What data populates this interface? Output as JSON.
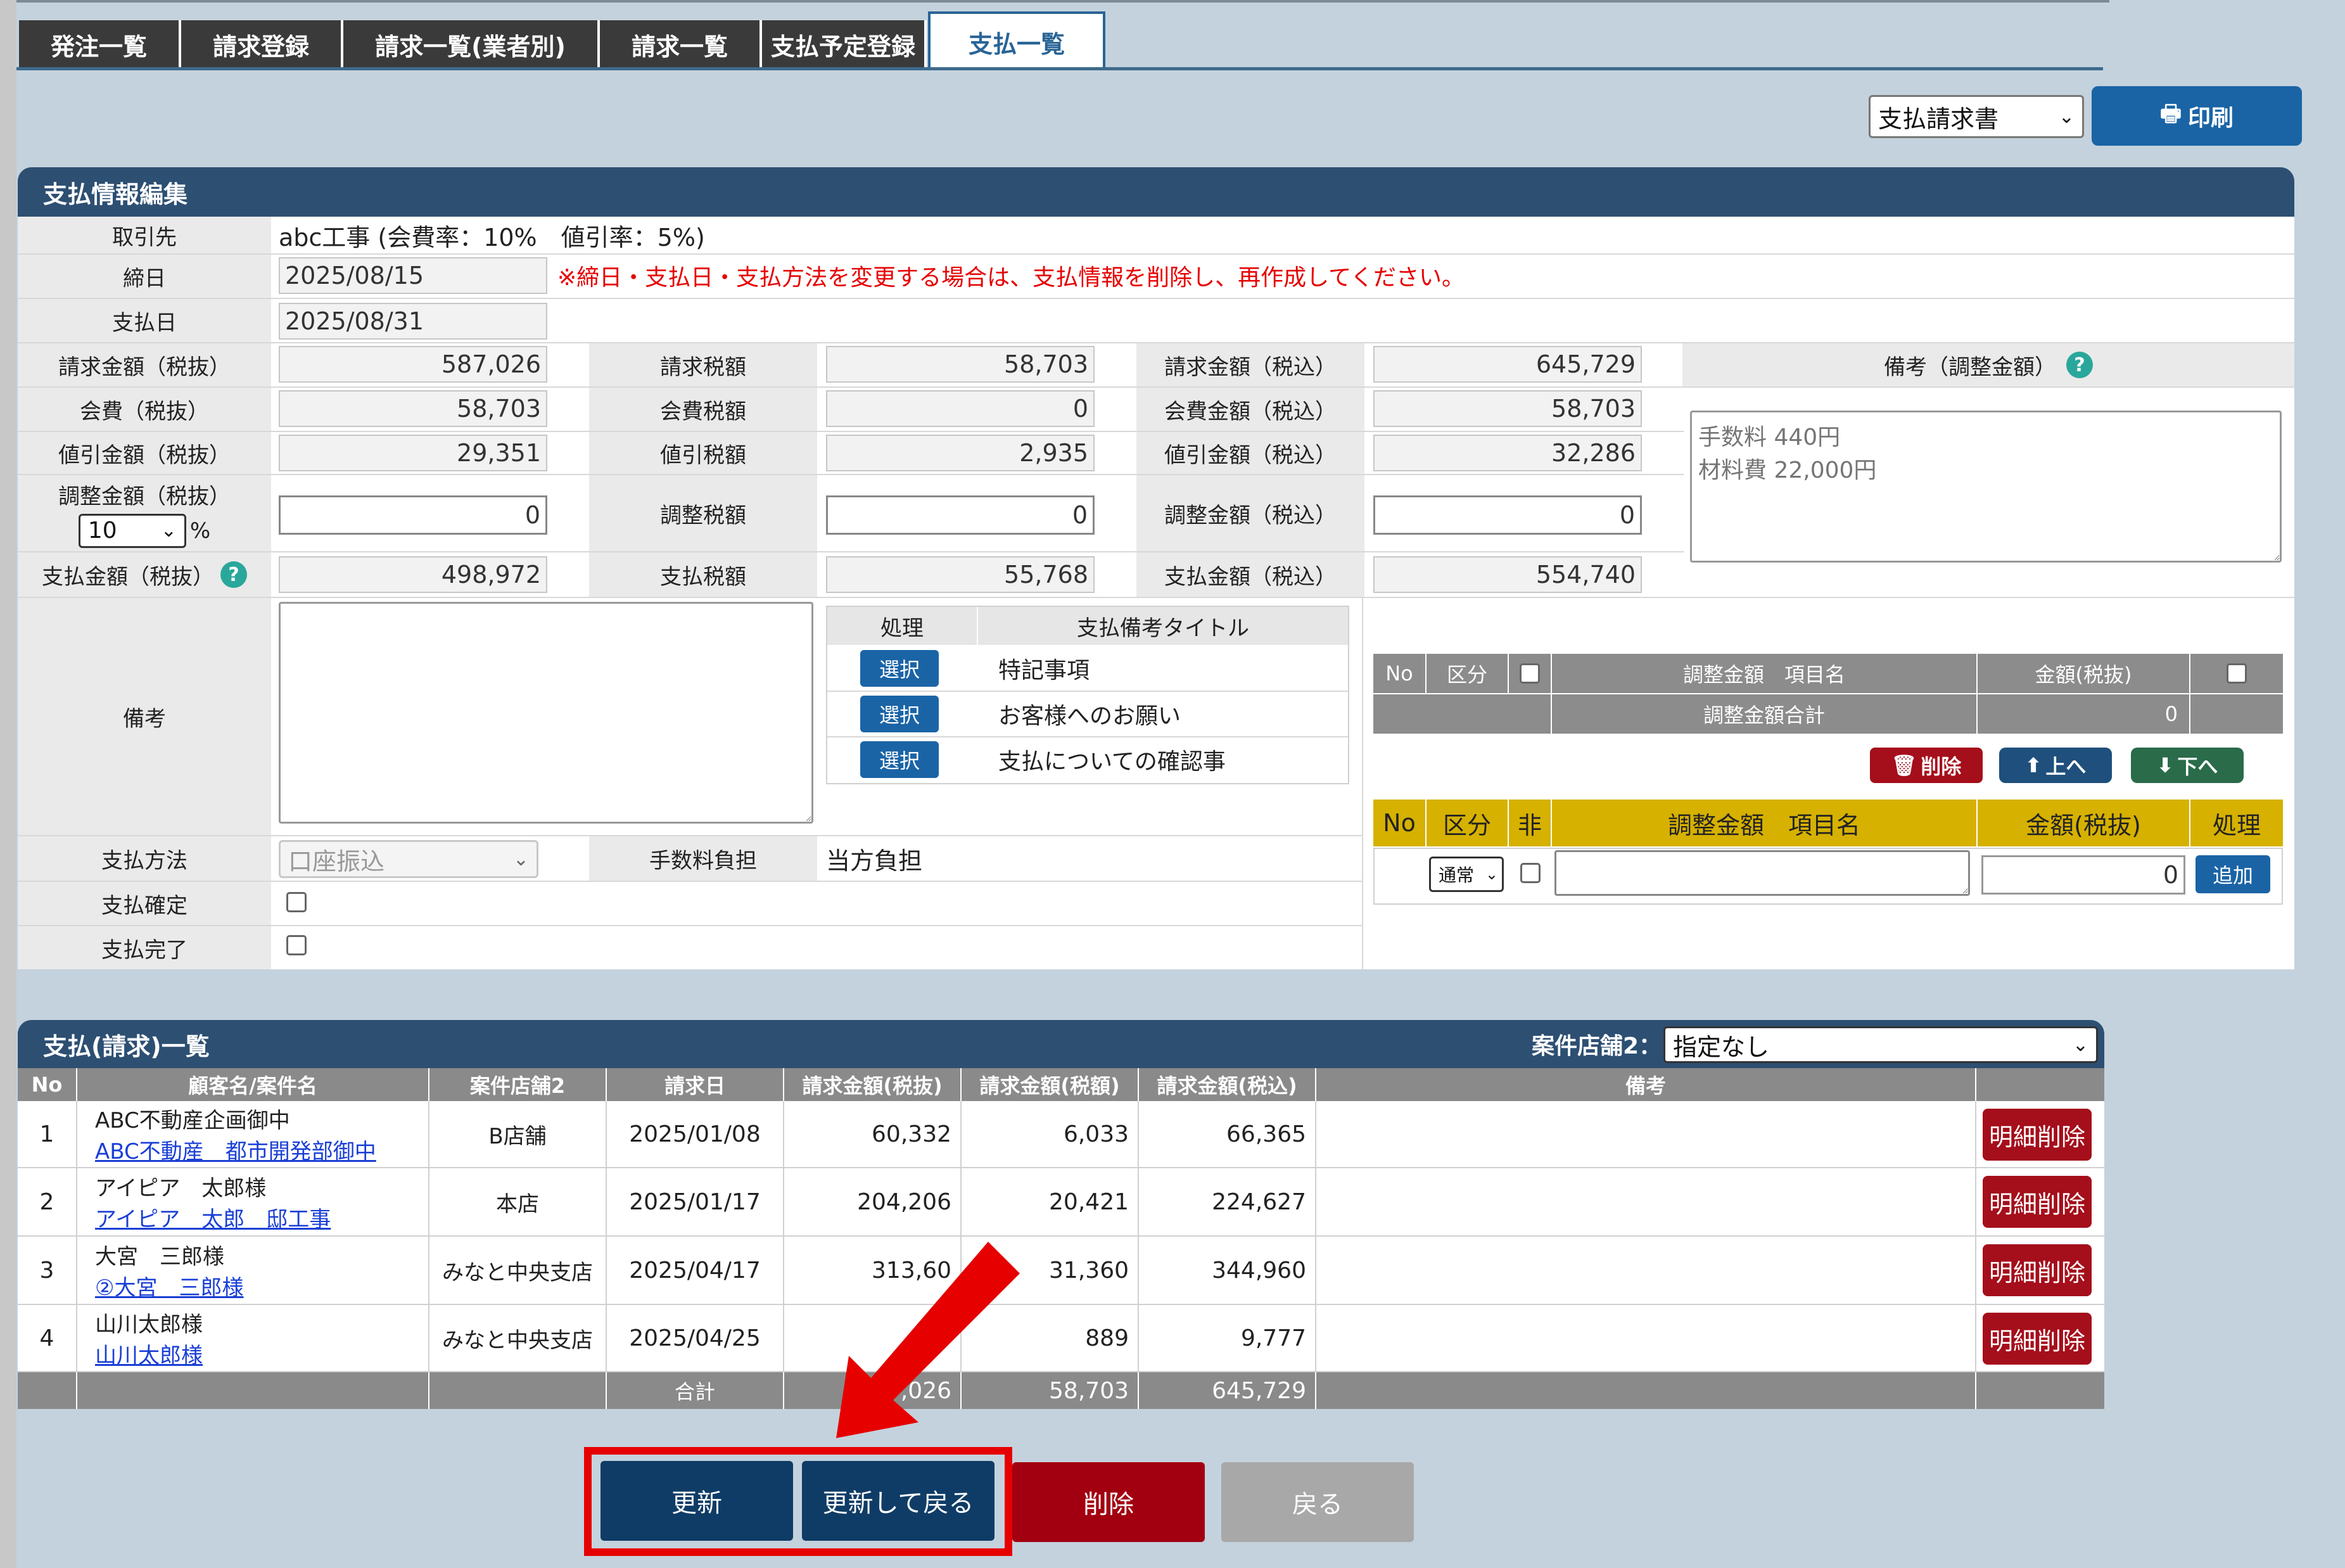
{
  "tabs": [
    "発注一覧",
    "請求登録",
    "請求一覧(業者別)",
    "請求一覧",
    "支払予定登録",
    "支払一覧"
  ],
  "print": {
    "select_value": "支払請求書",
    "button": "印刷"
  },
  "panel_title": "支払情報編集",
  "client": {
    "label": "取引先",
    "value": "abc工事 (会費率：10%　値引率：5%)"
  },
  "close_date": {
    "label": "締日",
    "value": "2025/08/15",
    "warning": "※締日・支払日・支払方法を変更する場合は、支払情報を削除し、再作成してください。"
  },
  "pay_date": {
    "label": "支払日",
    "value": "2025/08/31"
  },
  "amounts": {
    "rows": [
      {
        "l1": "請求金額（税抜）",
        "v1": "587,026",
        "l2": "請求税額",
        "v2": "58,703",
        "l3": "請求金額（税込）",
        "v3": "645,729"
      },
      {
        "l1": "会費（税抜）",
        "v1": "58,703",
        "l2": "会費税額",
        "v2": "0",
        "l3": "会費金額（税込）",
        "v3": "58,703"
      },
      {
        "l1": "値引金額（税抜）",
        "v1": "29,351",
        "l2": "値引税額",
        "v2": "2,935",
        "l3": "値引金額（税込）",
        "v3": "32,286"
      },
      {
        "l1": "調整金額（税抜）",
        "v1": "0",
        "l2": "調整税額",
        "v2": "0",
        "l3": "調整金額（税込）",
        "v3": "0"
      },
      {
        "l1": "支払金額（税抜）",
        "v1": "498,972",
        "l2": "支払税額",
        "v2": "55,768",
        "l3": "支払金額（税込）",
        "v3": "554,740"
      }
    ],
    "tax_rate": "10",
    "percent": "%"
  },
  "notes": {
    "label": "備考（調整金額）",
    "placeholder": "手数料 440円\n材料費 22,000円"
  },
  "remarks": {
    "label": "備考"
  },
  "templates": {
    "headers": [
      "処理",
      "支払備考タイトル"
    ],
    "button": "選択",
    "items": [
      "特記事項",
      "お客様へのお願い",
      "支払についての確認事"
    ]
  },
  "adj_table": {
    "headers": [
      "No",
      "区分",
      "調整金額　項目名",
      "金額(税抜)"
    ],
    "total_label": "調整金額合計",
    "total_value": "0",
    "buttons": [
      "削除",
      "上へ",
      "下へ"
    ]
  },
  "adj_entry": {
    "headers": [
      "No",
      "区分",
      "非",
      "調整金額　項目名",
      "金額(税抜)",
      "処理"
    ],
    "kubun": "通常",
    "amount": "0",
    "add": "追加"
  },
  "method": {
    "label": "支払方法",
    "value": "口座振込",
    "fee_label": "手数料負担",
    "fee_value": "当方負担"
  },
  "confirm": {
    "label": "支払確定"
  },
  "complete": {
    "label": "支払完了"
  },
  "list": {
    "title": "支払(請求)一覧",
    "filter_label": "案件店舗2：",
    "filter_value": "指定なし",
    "headers": [
      "No",
      "顧客名/案件名",
      "案件店舗2",
      "請求日",
      "請求金額(税抜)",
      "請求金額(税額)",
      "請求金額(税込)",
      "備考",
      ""
    ],
    "rows": [
      {
        "no": "1",
        "customer": "ABC不動産企画御中",
        "project": "ABC不動産　都市開発部御中",
        "store": "B店舗",
        "date": "2025/01/08",
        "ex": "60,332",
        "tax": "6,033",
        "inc": "66,365"
      },
      {
        "no": "2",
        "customer": "アイピア　太郎様",
        "project": "アイピア　太郎　邸工事",
        "store": "本店",
        "date": "2025/01/17",
        "ex": "204,206",
        "tax": "20,421",
        "inc": "224,627"
      },
      {
        "no": "3",
        "customer": "大宮　三郎様",
        "project": "②大宮　三郎様",
        "store": "みなと中央支店",
        "date": "2025/04/17",
        "ex": "313,60",
        "tax": "31,360",
        "inc": "344,960"
      },
      {
        "no": "4",
        "customer": "山川太郎様",
        "project": "山川太郎様",
        "store": "みなと中央支店",
        "date": "2025/04/25",
        "ex": "",
        "tax": "889",
        "inc": "9,777"
      }
    ],
    "row_delete": "明細削除",
    "total_label": "合計",
    "total_ex": ",026",
    "total_tax": "58,703",
    "total_inc": "645,729"
  },
  "actions": {
    "update": "更新",
    "update_back": "更新して戻る",
    "delete": "削除",
    "back": "戻る"
  },
  "colors": {
    "accent": "#1a64a6",
    "danger": "#a50e1b",
    "header": "#2d4f72",
    "highlight": "#e60000"
  }
}
